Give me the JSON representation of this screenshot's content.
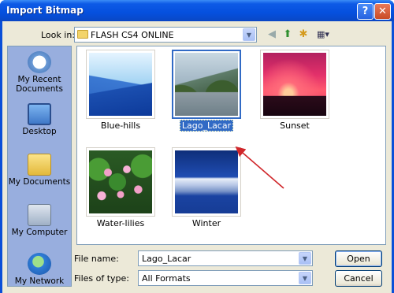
{
  "window": {
    "title": "Import Bitmap",
    "help_glyph": "?",
    "close_glyph": "✕"
  },
  "toolbar": {
    "look_in_label": "Look in:",
    "look_in_value": "FLASH CS4 ONLINE",
    "back_glyph": "◀",
    "up_glyph": "⬆",
    "new_folder_glyph": "✱",
    "views_glyph": "▦▾"
  },
  "places": [
    {
      "label": "My Recent Documents",
      "icon": "recent-documents-icon"
    },
    {
      "label": "Desktop",
      "icon": "desktop-icon"
    },
    {
      "label": "My Documents",
      "icon": "my-documents-icon"
    },
    {
      "label": "My Computer",
      "icon": "my-computer-icon"
    },
    {
      "label": "My Network",
      "icon": "my-network-icon"
    }
  ],
  "files": [
    {
      "label": "Blue-hills",
      "selected": false
    },
    {
      "label": "Lago_Lacar",
      "selected": true
    },
    {
      "label": "Sunset",
      "selected": false
    },
    {
      "label": "Water-lilies",
      "selected": false
    },
    {
      "label": "Winter",
      "selected": false
    }
  ],
  "form": {
    "file_name_label": "File name:",
    "file_name_value": "Lago_Lacar",
    "file_type_label": "Files of type:",
    "file_type_value": "All Formats"
  },
  "buttons": {
    "open": "Open",
    "cancel": "Cancel"
  },
  "colors": {
    "titlebar": "#0550de",
    "selection": "#316ac5",
    "arrow": "#d0272b"
  }
}
